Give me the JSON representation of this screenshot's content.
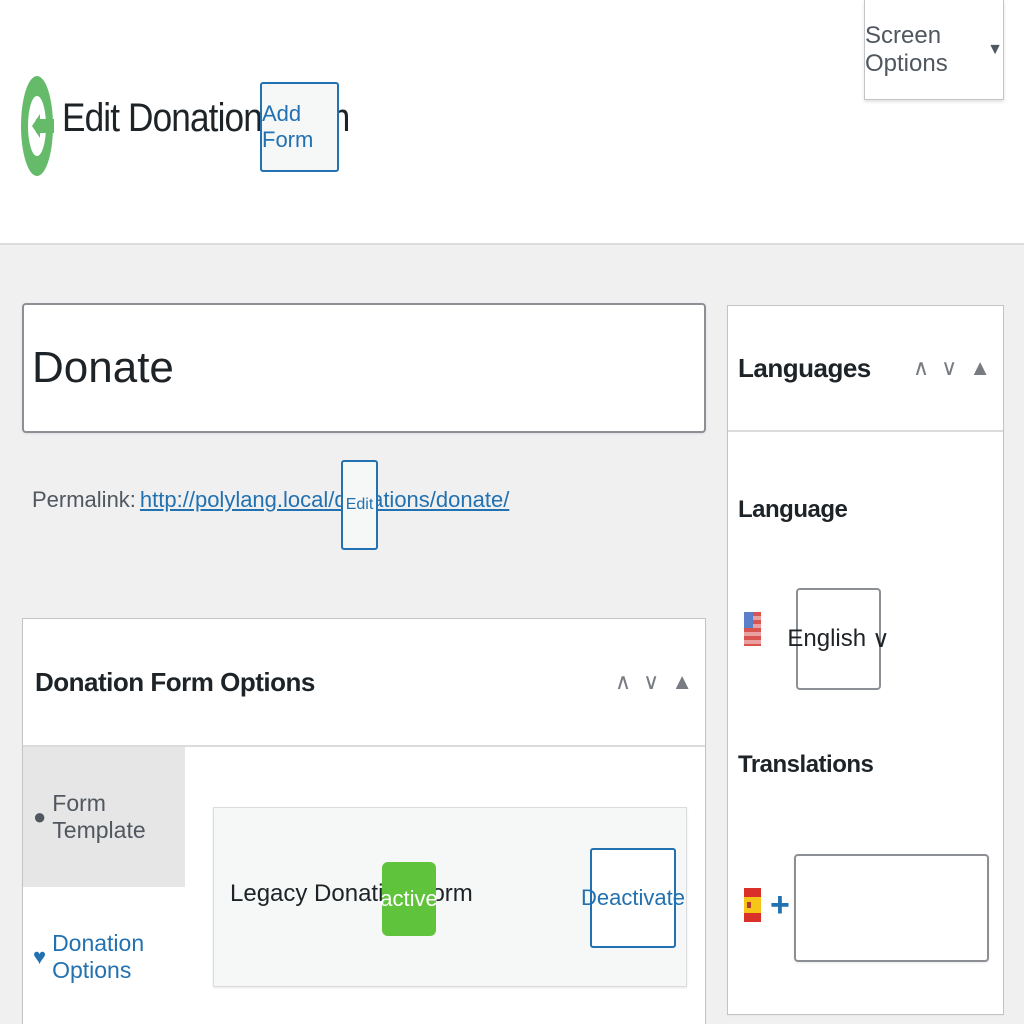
{
  "header": {
    "title": "Edit Donation Form",
    "add_form_label": "Add Form",
    "screen_options_label": "Screen Options",
    "screen_options_caret": "▼"
  },
  "post": {
    "title_value": "Donate",
    "permalink_label": "Permalink:",
    "permalink_url": "http://polylang.local/donations/donate/",
    "edit_label": "Edit"
  },
  "donation_form_options": {
    "title": "Donation Form Options",
    "controls": [
      "∧",
      "∨",
      "▲"
    ],
    "tabs": [
      {
        "label": "Form Template",
        "icon": "palette-icon",
        "glyph": "🎨"
      },
      {
        "label": "Donation Options",
        "icon": "heart-icon",
        "glyph": "♥"
      }
    ],
    "template": {
      "name": "Legacy Donation Form",
      "status": "active",
      "deactivate_label": "Deactivate"
    }
  },
  "languages": {
    "title": "Languages",
    "controls": [
      "∧",
      "∨",
      "▲"
    ],
    "language_label": "Language",
    "selected_language": "English",
    "select_caret": "∨",
    "translations_label": "Translations",
    "add_translation_glyph": "+",
    "translation_value": ""
  },
  "colors": {
    "accent": "#2271b1",
    "active_badge": "#5fc33b",
    "logo_green": "#66bb6a"
  }
}
